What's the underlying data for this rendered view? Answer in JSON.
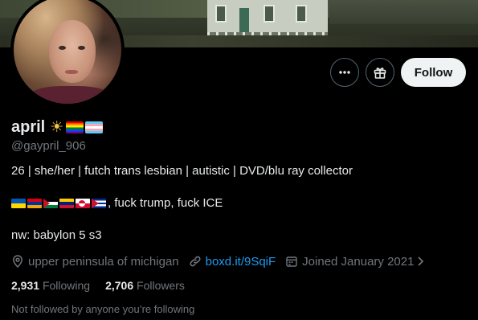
{
  "profile": {
    "display_name": "april",
    "emoji_icons": [
      "sun-icon",
      "rainbow-flag-icon",
      "transgender-flag-icon"
    ],
    "handle": "@gaypril_906",
    "bio": {
      "line1": "26 | she/her | futch trans lesbian | autistic | DVD/blu ray collector",
      "line2_flags": [
        "ukraine-flag-icon",
        "armenia-flag-icon",
        "palestine-flag-icon",
        "venezuela-flag-icon",
        "greenland-flag-icon",
        "cuba-flag-icon"
      ],
      "line2_text": ", fuck trump, fuck ICE",
      "line3": "nw: babylon 5 s3"
    },
    "location": "upper peninsula of michigan",
    "website": "boxd.it/9SqiF",
    "joined": "Joined January 2021",
    "following_count": "2,931",
    "following_label": "Following",
    "followers_count": "2,706",
    "followers_label": "Followers",
    "not_followed_text": "Not followed by anyone you’re following"
  },
  "actions": {
    "more_icon": "more-horizontal-icon",
    "gift_icon": "gift-icon",
    "follow_label": "Follow"
  },
  "colors": {
    "background": "#000000",
    "text_primary": "#e7e9ea",
    "text_secondary": "#71767b",
    "link": "#1d9bf0",
    "follow_button_bg": "#eff3f4",
    "button_border": "#536471"
  }
}
